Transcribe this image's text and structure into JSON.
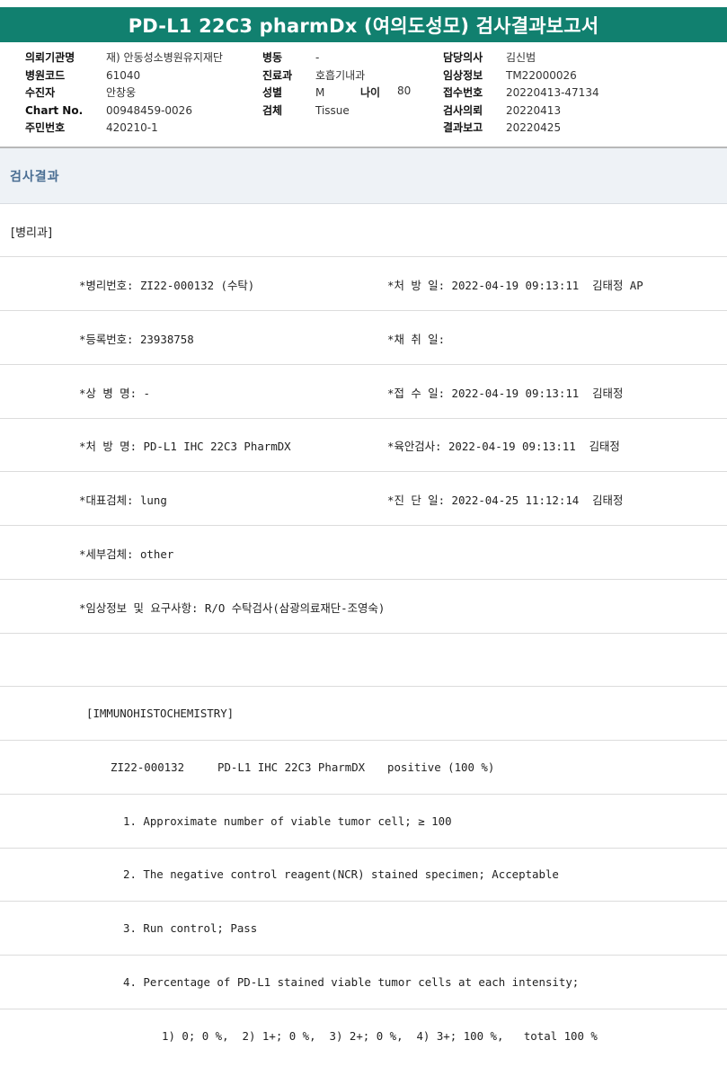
{
  "title": "PD-L1 22C3 pharmDx (여의도성모) 검사결과보고서",
  "header": {
    "col1": [
      {
        "label": "의뢰기관명",
        "value": "재) 안동성소병원유지재단"
      },
      {
        "label": "병원코드",
        "value": "61040"
      },
      {
        "label": "수진자",
        "value": "안창웅"
      },
      {
        "label": "Chart No.",
        "value": "00948459-0026"
      },
      {
        "label": "주민번호",
        "value": "420210-1"
      }
    ],
    "col2": [
      {
        "label": "병동",
        "value": "-"
      },
      {
        "label": "진료과",
        "value": "호흡기내과"
      },
      {
        "label": "성별",
        "value": "M"
      },
      {
        "label": "검체",
        "value": "Tissue"
      }
    ],
    "age": {
      "label": "나이",
      "value": "80"
    },
    "col3": [
      {
        "label": "담당의사",
        "value": "김신범"
      },
      {
        "label": "임상정보",
        "value": "TM22000026"
      },
      {
        "label": "접수번호",
        "value": "20220413-47134"
      },
      {
        "label": "검사의뢰",
        "value": "20220413"
      },
      {
        "label": "결과보고",
        "value": "20220425"
      }
    ]
  },
  "section_title": "검사결과",
  "dept": "[병리과]",
  "fields": {
    "pathology_no": "*병리번호: ZI22-000132 (수탁)",
    "order_date": "*처 방 일: 2022-04-19 09:13:11  김태정 AP",
    "reg_no": "*등록번호: 23938758",
    "collect_date": "*채 취 일:",
    "diagnosis_name": "*상 병 명: -",
    "receipt_date": "*접 수 일: 2022-04-19 09:13:11  김태정",
    "order_name": "*처 방 명: PD-L1 IHC 22C3 PharmDX",
    "gross_exam": "*육안검사: 2022-04-19 09:13:11  김태정",
    "rep_specimen": "*대표검체: lung",
    "diagnosis_date": "*진 단 일: 2022-04-25 11:12:14  김태정",
    "detail_specimen": "*세부검체: other",
    "clinical_info": "*임상정보 및 요구사항: R/O 수탁검사(삼광의료재단-조영숙)"
  },
  "ihc": {
    "heading": "[IMMUNOHISTOCHEMISTRY]",
    "case_id": "ZI22-000132",
    "test": "PD-L1 IHC 22C3 PharmDX",
    "result": "positive (100 %)",
    "item1": "1. Approximate number of viable tumor cell; ≥ 100",
    "item2": "2. The negative control reagent(NCR) stained specimen; Acceptable",
    "item3": "3. Run control; Pass",
    "item4": "4. Percentage of PD-L1 stained viable tumor cells at each intensity;",
    "intensity": "1) 0; 0 %,  2) 1+; 0 %,  3) 2+; 0 %,  4) 3+; 100 %,   total 100 %"
  }
}
